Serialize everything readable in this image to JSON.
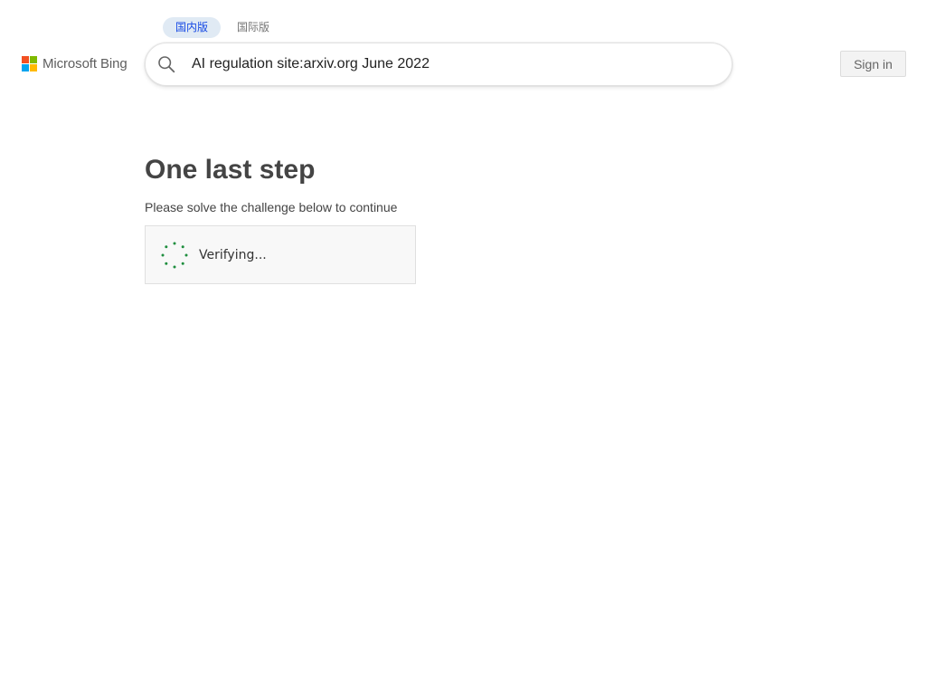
{
  "region_tabs": [
    {
      "label": "国内版",
      "active": true
    },
    {
      "label": "国际版",
      "active": false
    }
  ],
  "logo": {
    "text": "Microsoft Bing",
    "colors": [
      "#f25022",
      "#7fba00",
      "#00a4ef",
      "#ffb900"
    ]
  },
  "search": {
    "value": "AI regulation site:arxiv.org June 2022",
    "icon": "search-icon"
  },
  "header": {
    "signin_label": "Sign in"
  },
  "challenge": {
    "title": "One last step",
    "subtitle": "Please solve the challenge below to continue",
    "status": "Verifying...",
    "spinner_color": "#1e8e3e"
  }
}
